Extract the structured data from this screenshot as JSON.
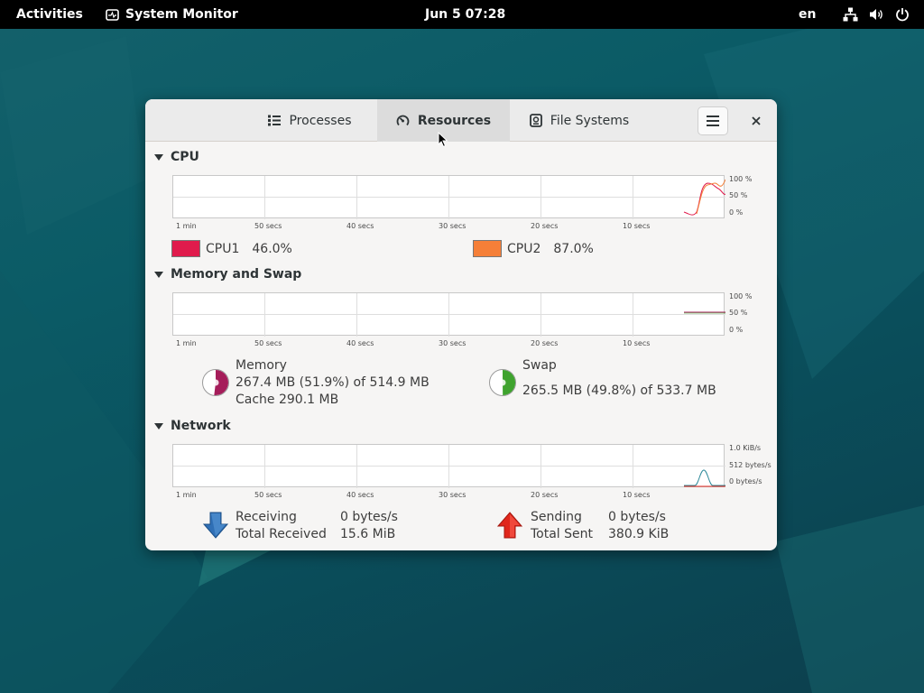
{
  "topbar": {
    "activities": "Activities",
    "app_name": "System Monitor",
    "clock": "Jun 5  07:28",
    "language": "en",
    "icons": [
      "network-icon",
      "volume-icon",
      "power-icon"
    ]
  },
  "tabs": [
    {
      "label": "Processes",
      "icon": "list-icon",
      "active": false
    },
    {
      "label": "Resources",
      "icon": "gauge-icon",
      "active": true
    },
    {
      "label": "File Systems",
      "icon": "disk-icon",
      "active": false
    }
  ],
  "time_axis": [
    "1 min",
    "50 secs",
    "40 secs",
    "30 secs",
    "20 secs",
    "10 secs"
  ],
  "cpu": {
    "title": "CPU",
    "y_labels": [
      "100 %",
      "50 %",
      "0 %"
    ],
    "cpus": [
      {
        "label": "CPU1",
        "value": "46.0%",
        "color": "#e01b4c"
      },
      {
        "label": "CPU2",
        "value": "87.0%",
        "color": "#f57f38"
      }
    ]
  },
  "memory": {
    "title": "Memory and Swap",
    "y_labels": [
      "100 %",
      "50 %",
      "0 %"
    ],
    "memory_label": "Memory",
    "memory_usage": "267.4 MB (51.9%) of 514.9 MB",
    "memory_cache": "Cache 290.1 MB",
    "memory_fraction": 0.519,
    "memory_color": "#a51d5a",
    "swap_label": "Swap",
    "swap_usage": "265.5 MB (49.8%) of 533.7 MB",
    "swap_fraction": 0.498,
    "swap_color": "#3fa32e"
  },
  "network": {
    "title": "Network",
    "y_labels": [
      "1.0 KiB/s",
      "512 bytes/s",
      "0 bytes/s"
    ],
    "receiving_label": "Receiving",
    "receiving_value": "0 bytes/s",
    "total_received_label": "Total Received",
    "total_received_value": "15.6 MiB",
    "sending_label": "Sending",
    "sending_value": "0 bytes/s",
    "total_sent_label": "Total Sent",
    "total_sent_value": "380.9 KiB",
    "receiving_color": "#2f6fb5",
    "sending_color": "#e0261b"
  }
}
